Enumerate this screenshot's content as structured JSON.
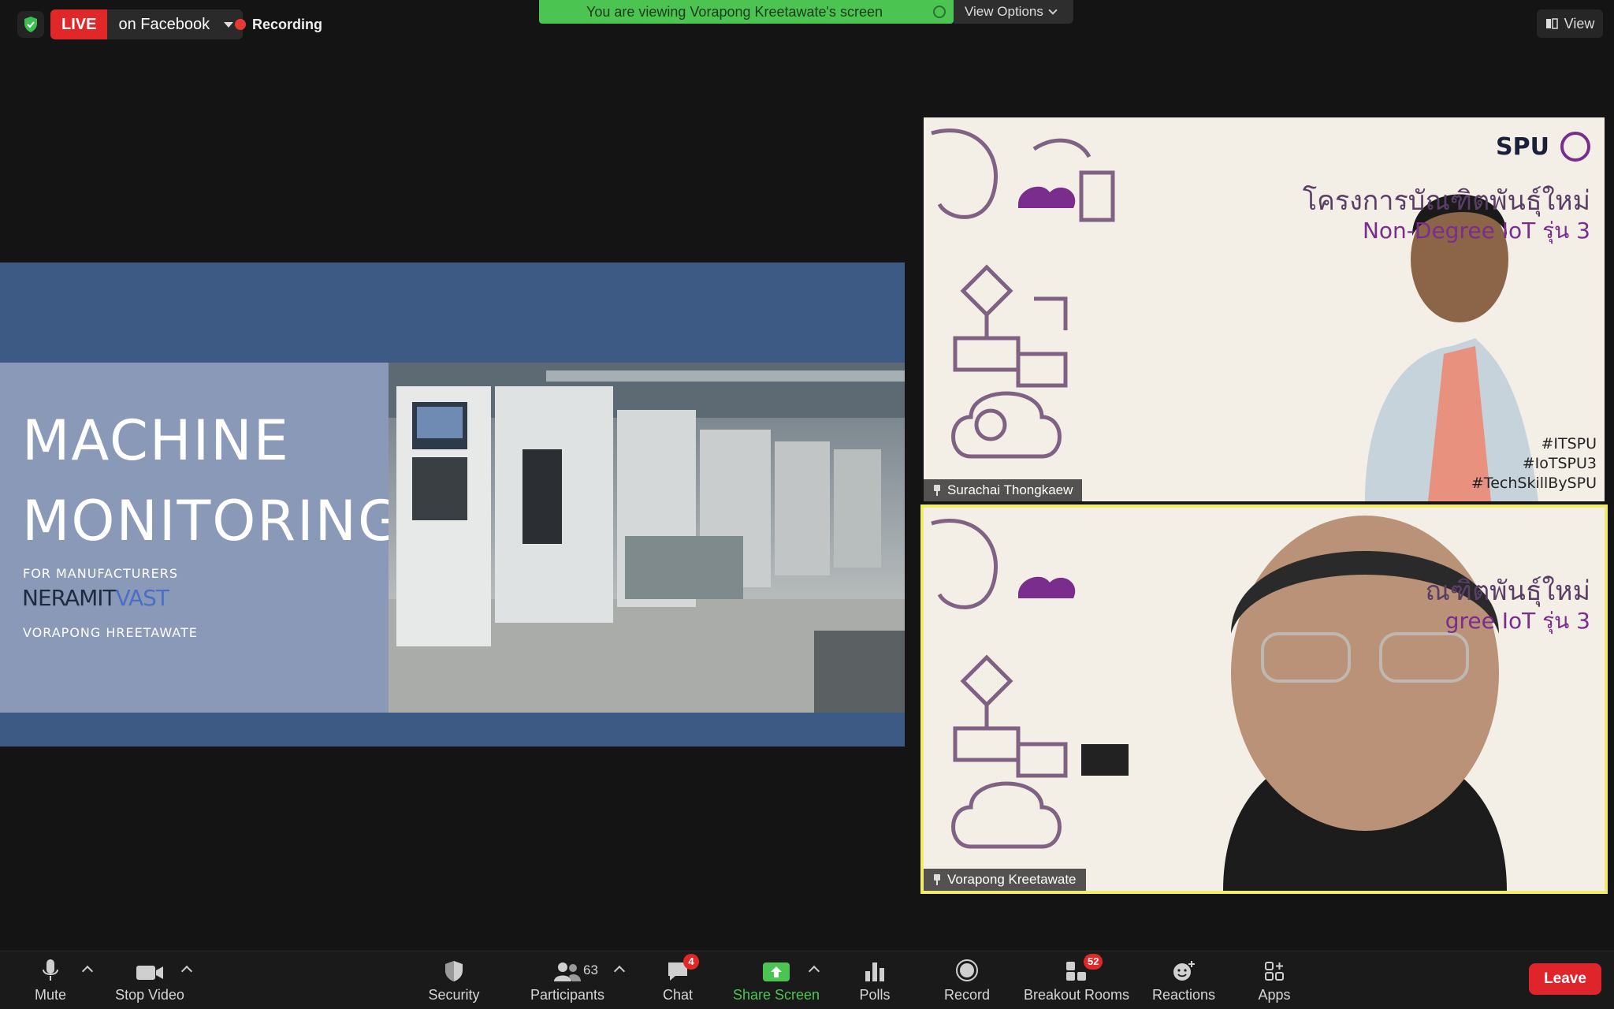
{
  "topbar": {
    "live_label": "LIVE",
    "live_target": "on Facebook",
    "recording_label": "Recording",
    "viewing_banner": "You are viewing Vorapong Kreetawate's screen",
    "view_options_label": "View Options",
    "view_label": "View"
  },
  "slide": {
    "title_line1": "MACHINE",
    "title_line2": "MONITORING",
    "subtitle": "FOR MANUFACTURERS",
    "brand_part1": "NERAMIT",
    "brand_part2": "VAST",
    "presenter": "VORAPONG HREETAWATE"
  },
  "videos": [
    {
      "name": "Surachai Thongkaew",
      "logo_text": "SPU",
      "title_th": "โครงการบัณฑิตพันธุ์ใหม่",
      "title_en": "Non-Degree IoT รุ่น 3",
      "hashtags": [
        "#ITSPU",
        "#IoTSPU3",
        "#TechSkillBySPU"
      ]
    },
    {
      "name": "Vorapong Kreetawate",
      "title_th": "ณฑิตพันธุ์ใหม่",
      "title_en": "gree IoT รุ่น 3"
    }
  ],
  "toolbar": {
    "mute": "Mute",
    "stop_video": "Stop Video",
    "security": "Security",
    "participants": "Participants",
    "participants_count": "63",
    "chat": "Chat",
    "chat_badge": "4",
    "share_screen": "Share Screen",
    "polls": "Polls",
    "record": "Record",
    "breakout_rooms": "Breakout Rooms",
    "breakout_badge": "52",
    "reactions": "Reactions",
    "apps": "Apps",
    "leave": "Leave"
  },
  "colors": {
    "live_red": "#e02828",
    "banner_green": "#4cc451",
    "active_speaker_border": "#f1ec6a",
    "slide_blue": "#3d5a85",
    "leave_red": "#e0242b"
  }
}
